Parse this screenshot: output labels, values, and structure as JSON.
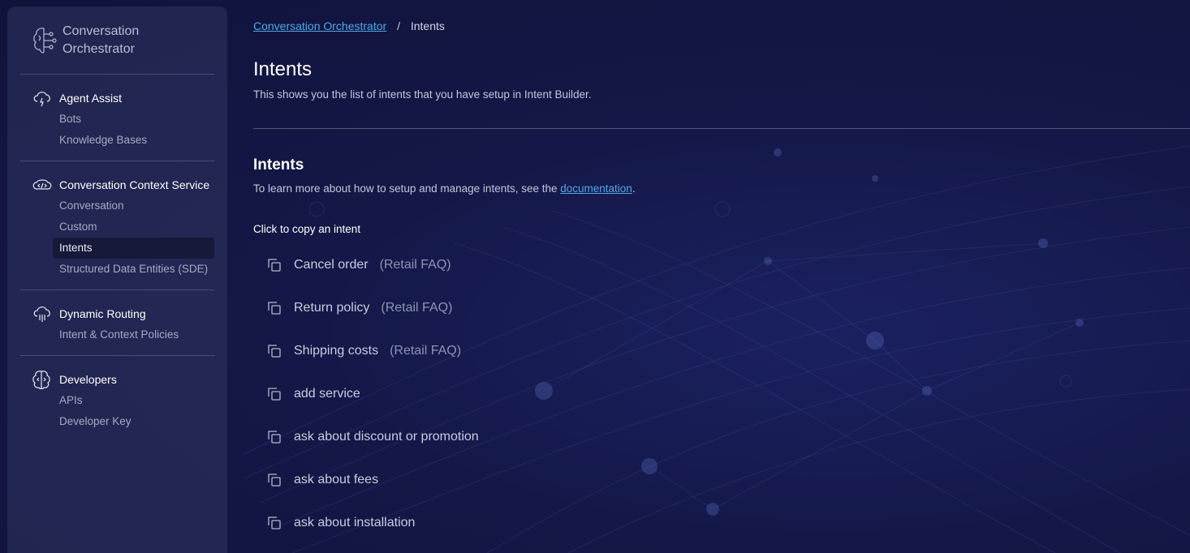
{
  "sidebar": {
    "brand": {
      "line1": "Conversation",
      "line2": "Orchestrator",
      "icon": "brain-circuit-icon"
    },
    "sections": [
      {
        "title": "Agent Assist",
        "icon": "cloud-bolt-icon",
        "items": [
          {
            "label": "Bots"
          },
          {
            "label": "Knowledge Bases"
          }
        ]
      },
      {
        "title": "Conversation Context Service",
        "icon": "code-cloud-icon",
        "items": [
          {
            "label": "Conversation"
          },
          {
            "label": "Custom"
          },
          {
            "label": "Intents",
            "active": true
          },
          {
            "label": "Structured Data Entities (SDE)"
          }
        ]
      },
      {
        "title": "Dynamic Routing",
        "icon": "cloud-routing-icon",
        "items": [
          {
            "label": "Intent & Context Policies"
          }
        ]
      },
      {
        "title": "Developers",
        "icon": "brain-code-icon",
        "items": [
          {
            "label": "APIs"
          },
          {
            "label": "Developer Key"
          }
        ]
      }
    ]
  },
  "breadcrumb": {
    "root": "Conversation Orchestrator",
    "separator": "/",
    "current": "Intents"
  },
  "page": {
    "title": "Intents",
    "subtitle": "This shows you the list of intents that you have setup in Intent Builder."
  },
  "intents_section": {
    "title": "Intents",
    "desc_prefix": "To learn more about how to setup and manage intents, see the ",
    "desc_link": "documentation",
    "desc_suffix": ".",
    "copy_hint": "Click to copy an intent",
    "items": [
      {
        "name": "Cancel order",
        "tag": "(Retail FAQ)"
      },
      {
        "name": "Return policy",
        "tag": "(Retail FAQ)"
      },
      {
        "name": "Shipping costs",
        "tag": "(Retail FAQ)"
      },
      {
        "name": "add service",
        "tag": ""
      },
      {
        "name": "ask about discount or promotion",
        "tag": ""
      },
      {
        "name": "ask about fees",
        "tag": ""
      },
      {
        "name": "ask about installation",
        "tag": ""
      }
    ]
  },
  "colors": {
    "link": "#4fa8e8",
    "background": "#141848",
    "sidebar": "#303460"
  }
}
